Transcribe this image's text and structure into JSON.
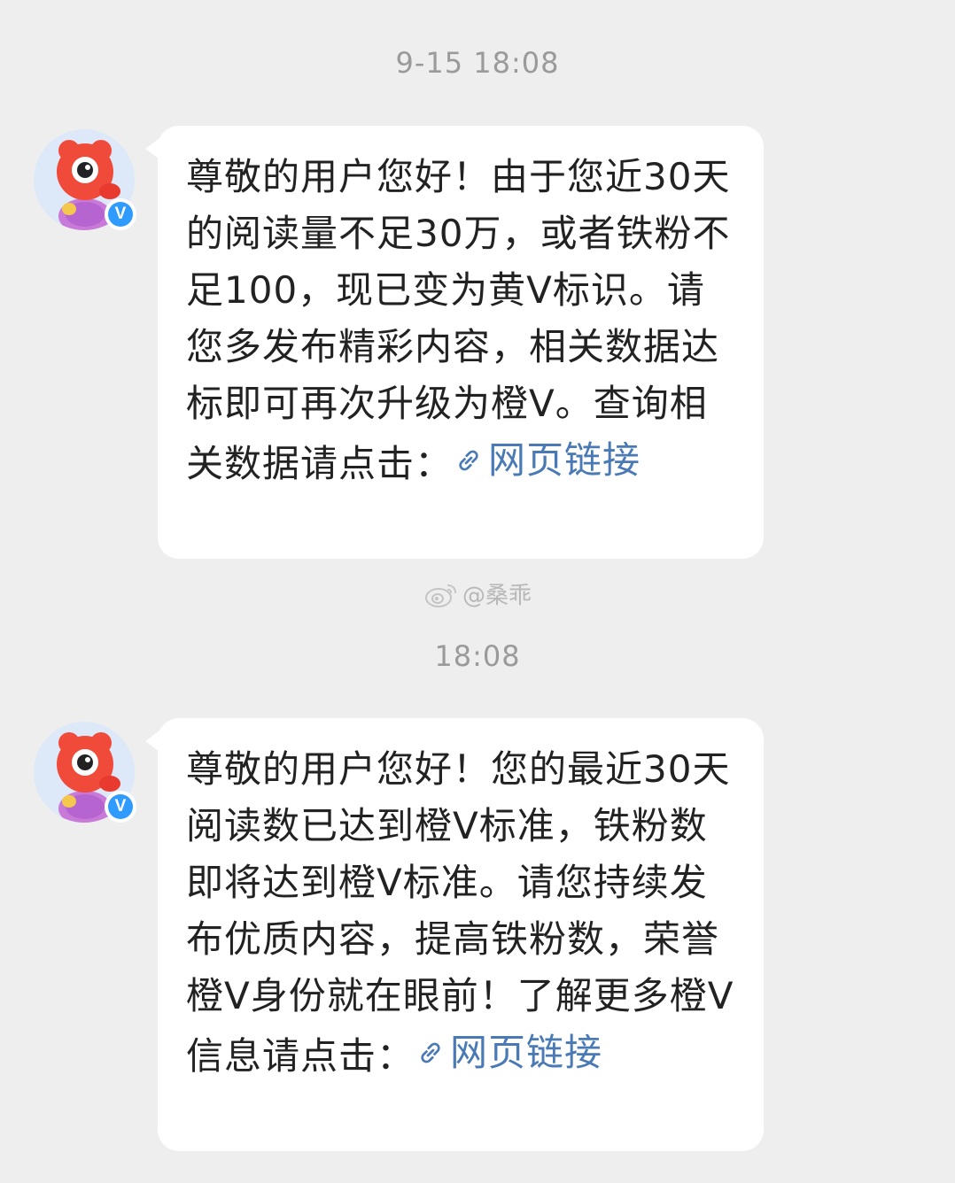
{
  "conversation": {
    "messages": [
      {
        "timestamp": "9-15 18:08",
        "text": "尊敬的用户您好！由于您近30天的阅读量不足30万，或者铁粉不足100，现已变为黄V标识。请您多发布精彩内容，相关数据达标即可再次升级为橙V。查询相关数据请点击：",
        "link_label": "网页链接",
        "verified_badge": "V"
      },
      {
        "timestamp": "18:08",
        "text": "尊敬的用户您好！您的最近30天阅读数已达到橙V标准，铁粉数即将达到橙V标准。请您持续发布优质内容，提高铁粉数，荣誉橙V身份就在眼前！了解更多橙V信息请点击：",
        "link_label": "网页链接",
        "verified_badge": "V"
      }
    ],
    "watermark": "@桑乖"
  },
  "colors": {
    "background": "#eeeeee",
    "bubble": "#ffffff",
    "link": "#4a7ab5",
    "timestamp": "#9a9a9a",
    "verified_badge": "#2f9bff"
  }
}
